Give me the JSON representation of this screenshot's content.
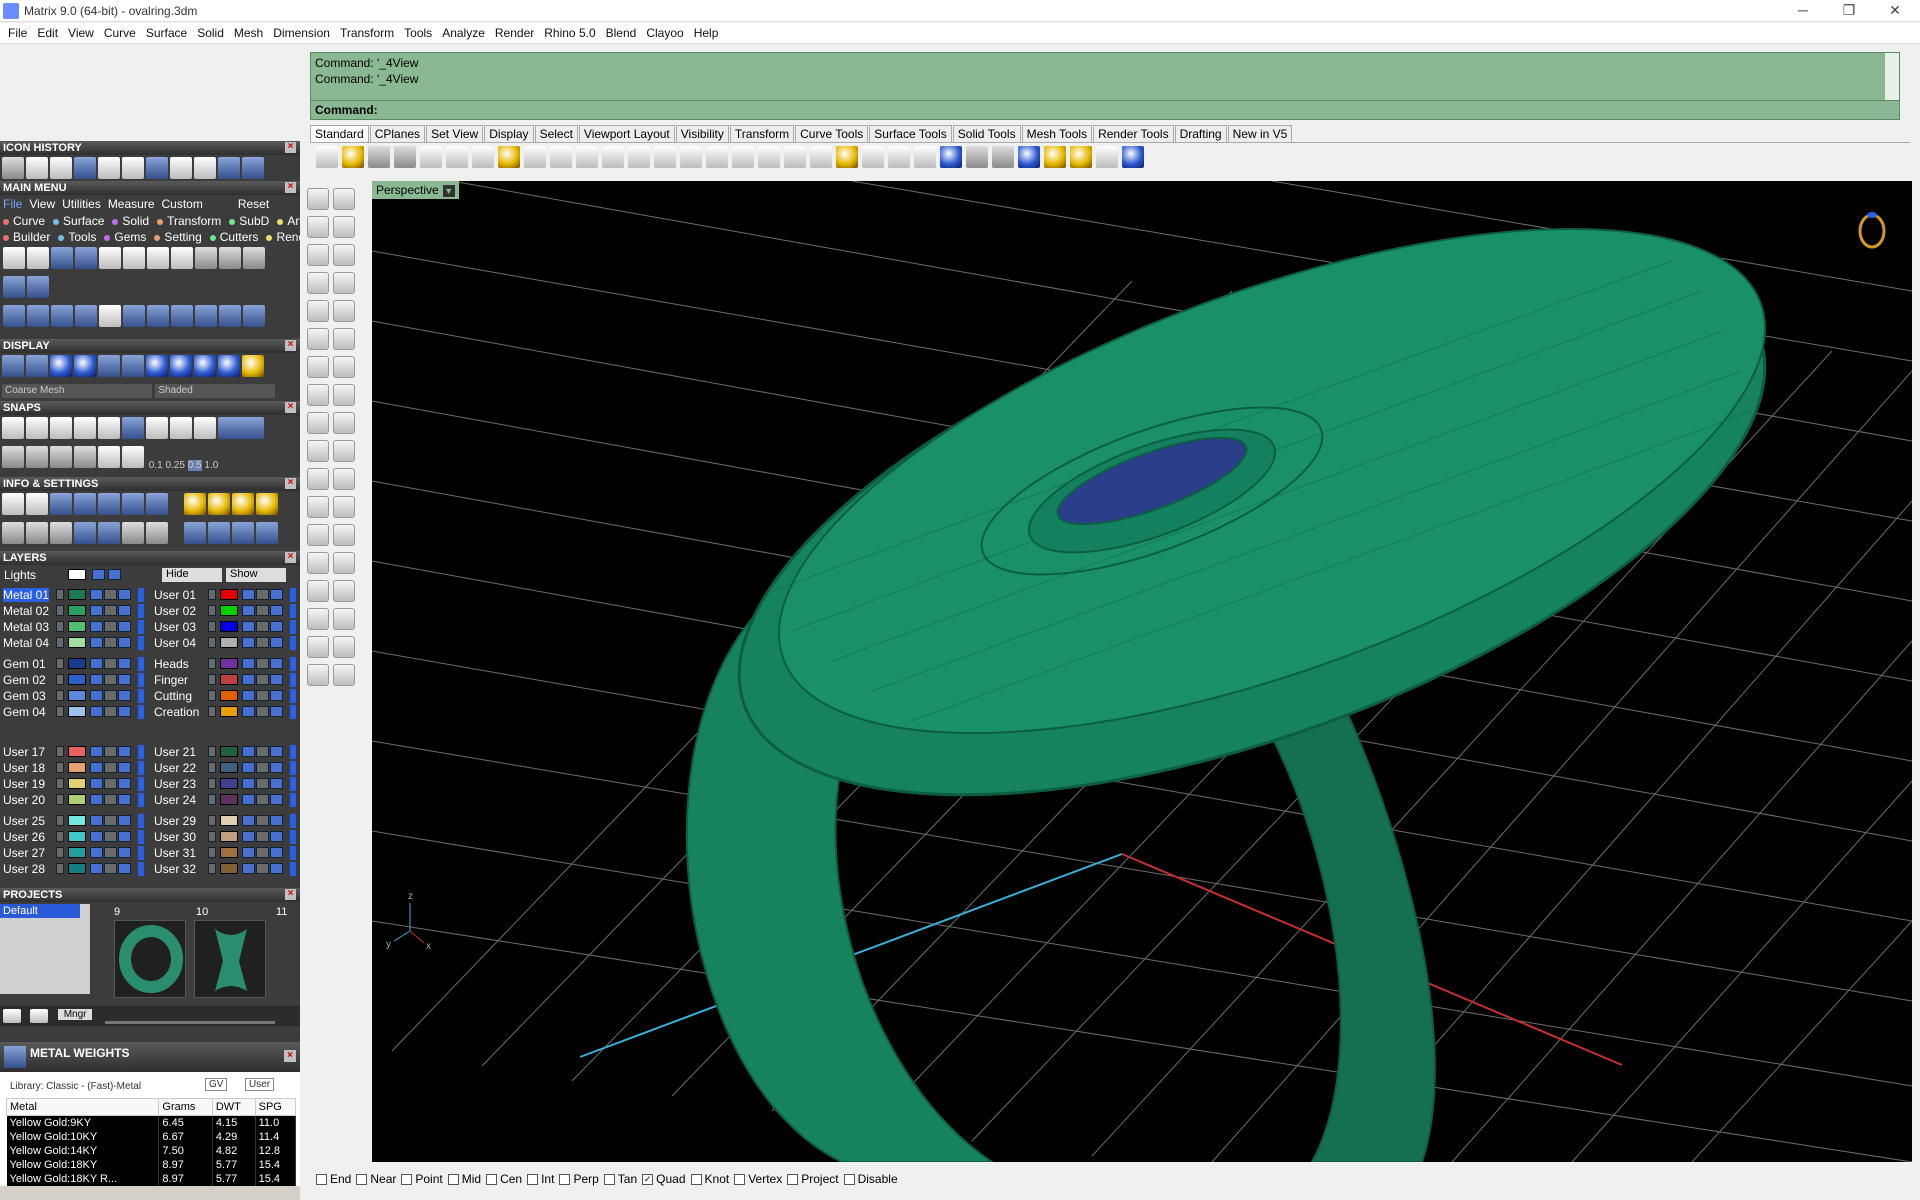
{
  "window": {
    "title": "Matrix 9.0 (64-bit) - ovalring.3dm"
  },
  "menu": [
    "File",
    "Edit",
    "View",
    "Curve",
    "Surface",
    "Solid",
    "Mesh",
    "Dimension",
    "Transform",
    "Tools",
    "Analyze",
    "Render",
    "Rhino 5.0",
    "Blend",
    "Clayoo",
    "Help"
  ],
  "panels": {
    "icon_history": "ICON HISTORY",
    "main_menu": "MAIN MENU",
    "display": "DISPLAY",
    "snaps": "SNAPS",
    "info": "INFO & SETTINGS",
    "layers": "LAYERS",
    "projects": "PROJECTS",
    "metal": "METAL WEIGHTS"
  },
  "main_menu": {
    "tabs": [
      "File",
      "View",
      "Utilities",
      "Measure",
      "Custom",
      "Reset"
    ],
    "row1": [
      "Curve",
      "Surface",
      "Solid",
      "Transform",
      "SubD",
      "Art"
    ],
    "row2": [
      "Builder",
      "Tools",
      "Gems",
      "Setting",
      "Cutters",
      "Render"
    ]
  },
  "display": {
    "mesh": "Coarse Mesh",
    "mode": "Shaded"
  },
  "snaps": {
    "vals": [
      "0.1",
      "0.25",
      "0.5",
      "1.0"
    ]
  },
  "layers": {
    "lights": "Lights",
    "hide": "Hide",
    "show": "Show",
    "left": [
      "Metal 01",
      "Metal 02",
      "Metal 03",
      "Metal 04",
      "Gem 01",
      "Gem 02",
      "Gem 03",
      "Gem 04",
      "User 17",
      "User 18",
      "User 19",
      "User 20",
      "User 25",
      "User 26",
      "User 27",
      "User 28"
    ],
    "right": [
      "User 01",
      "User 02",
      "User 03",
      "User 04",
      "Heads",
      "Finger",
      "Cutting",
      "Creation",
      "User 21",
      "User 22",
      "User 23",
      "User 24",
      "User 29",
      "User 30",
      "User 31",
      "User 32"
    ]
  },
  "projects": {
    "default": "Default",
    "nums": [
      "9",
      "10",
      "11"
    ],
    "mngr": "Mngr"
  },
  "metal": {
    "library": "Library: Classic - (Fast)-Metal",
    "gv": "GV",
    "user": "User",
    "cols": [
      "Metal",
      "Grams",
      "DWT",
      "SPG"
    ],
    "rows": [
      [
        "Yellow Gold:9KY",
        "6.45",
        "4.15",
        "11.0"
      ],
      [
        "Yellow Gold:10KY",
        "6.67",
        "4.29",
        "11.4"
      ],
      [
        "Yellow Gold:14KY",
        "7.50",
        "4.82",
        "12.8"
      ],
      [
        "Yellow Gold:18KY",
        "8.97",
        "5.77",
        "15.4"
      ],
      [
        "Yellow Gold:18KY R...",
        "8.97",
        "5.77",
        "15.4"
      ]
    ]
  },
  "command": {
    "history": [
      "Command: '_4View",
      "Command: '_4View"
    ],
    "prompt": "Command:"
  },
  "tabs": [
    "Standard",
    "CPlanes",
    "Set View",
    "Display",
    "Select",
    "Viewport Layout",
    "Visibility",
    "Transform",
    "Curve Tools",
    "Surface Tools",
    "Solid Tools",
    "Mesh Tools",
    "Render Tools",
    "Drafting",
    "New in V5"
  ],
  "viewport": {
    "label": "Perspective"
  },
  "osnap": [
    {
      "l": "End",
      "c": false
    },
    {
      "l": "Near",
      "c": false
    },
    {
      "l": "Point",
      "c": false
    },
    {
      "l": "Mid",
      "c": false
    },
    {
      "l": "Cen",
      "c": false
    },
    {
      "l": "Int",
      "c": false
    },
    {
      "l": "Perp",
      "c": false
    },
    {
      "l": "Tan",
      "c": false
    },
    {
      "l": "Quad",
      "c": true
    },
    {
      "l": "Knot",
      "c": false
    },
    {
      "l": "Vertex",
      "c": false
    },
    {
      "l": "Project",
      "c": false
    },
    {
      "l": "Disable",
      "c": false
    }
  ],
  "colors": {
    "accent": "#8ab893",
    "model": "#17825e",
    "gem": "#2a3e8a"
  }
}
